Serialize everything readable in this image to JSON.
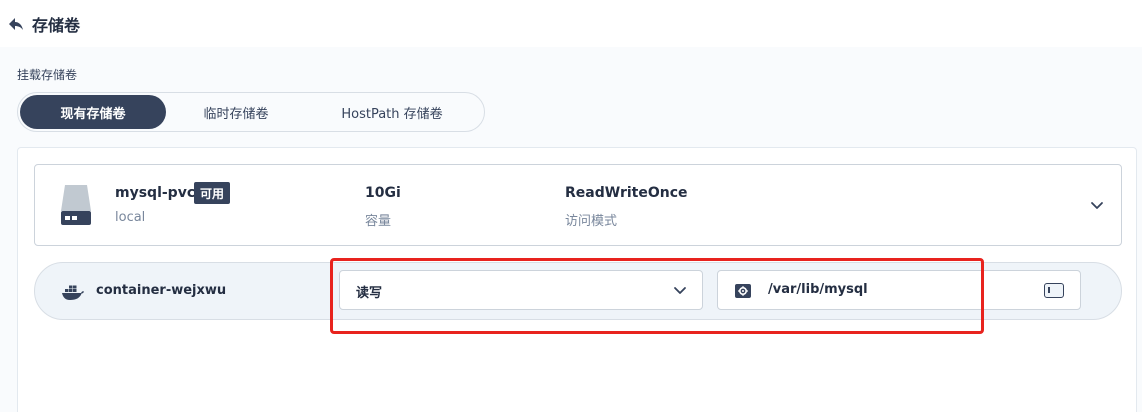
{
  "header": {
    "title": "存储卷",
    "back_icon": "back-arrow-icon"
  },
  "section_label": "挂载存储卷",
  "tabs": [
    {
      "label": "现有存储卷",
      "active": true
    },
    {
      "label": "临时存储卷",
      "active": false
    },
    {
      "label": "HostPath 存储卷",
      "active": false
    }
  ],
  "volume": {
    "icon": "disk-icon",
    "name": "mysql-pvc",
    "status": "可用",
    "storage_class": "local",
    "capacity": "10Gi",
    "capacity_label": "容量",
    "access_mode": "ReadWriteOnce",
    "access_mode_label": "访问模式"
  },
  "mount": {
    "container_icon": "docker-icon",
    "container_name": "container-wejxwu",
    "mode_selected": "读写",
    "mount_path": "/var/lib/mysql"
  },
  "colors": {
    "primary_dark": "#36435c",
    "annotation_red": "#e8231e",
    "panel_bg": "#f9fbfd"
  }
}
